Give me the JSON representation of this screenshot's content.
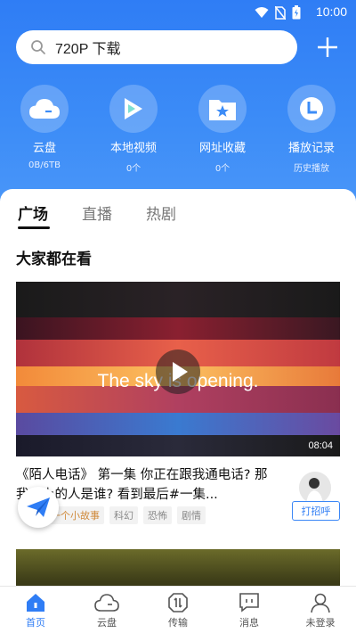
{
  "status_bar": {
    "time": "10:00"
  },
  "search": {
    "query": "720P 下载"
  },
  "quick_access": [
    {
      "label": "云盘",
      "sub": "0B/6TB",
      "icon": "cloud-icon"
    },
    {
      "label": "本地视频",
      "sub": "0个",
      "icon": "play-icon"
    },
    {
      "label": "网址收藏",
      "sub": "0个",
      "icon": "star-folder-icon"
    },
    {
      "label": "播放记录",
      "sub": "历史播放",
      "icon": "history-icon"
    }
  ],
  "tabs": [
    "广场",
    "直播",
    "热剧"
  ],
  "section_title": "大家都在看",
  "video": {
    "overlay_text": "The sky is opening.",
    "duration": "08:04",
    "title": "《陌人电话》 第一集  你正在跟我通电话? 那      我床上的人是谁? 看到最后#一集...",
    "tags": [
      "一个小故事",
      "科幻",
      "恐怖",
      "剧情"
    ],
    "call_button": "打招呼"
  },
  "bottom_nav": [
    {
      "label": "首页",
      "icon": "home-icon",
      "active": true
    },
    {
      "label": "云盘",
      "icon": "cloud-icon",
      "active": false
    },
    {
      "label": "传输",
      "icon": "transfer-icon",
      "active": false
    },
    {
      "label": "消息",
      "icon": "message-icon",
      "active": false
    },
    {
      "label": "未登录",
      "icon": "user-icon",
      "active": false
    }
  ],
  "colors": {
    "brand": "#2f7df5",
    "accent_tag": "#d08a3b"
  }
}
